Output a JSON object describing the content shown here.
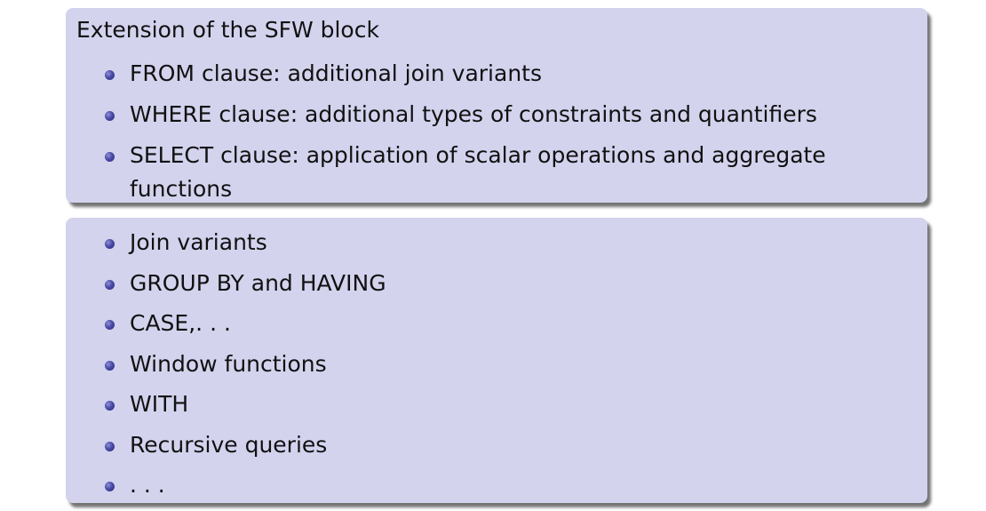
{
  "block1": {
    "intro": "Extension of the SFW block",
    "items": [
      "FROM clause: additional join variants",
      "WHERE clause: additional types of constraints and quantifiers",
      "SELECT clause: application of scalar operations and aggregate functions"
    ]
  },
  "block2": {
    "items": [
      "Join variants",
      "GROUP BY and HAVING",
      "CASE,. . .",
      "Window functions",
      "WITH",
      "Recursive queries",
      ". . ."
    ]
  },
  "colors": {
    "block_background": "#d3d3ee",
    "bullet": "#3a3a96"
  },
  "icons": [
    "bullet-icon"
  ]
}
